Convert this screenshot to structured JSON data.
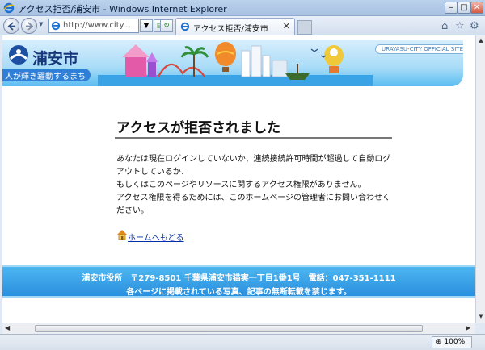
{
  "window": {
    "title": "アクセス拒否/浦安市 - Windows Internet Explorer",
    "minimize_icon": "minimize-icon",
    "maximize_icon": "maximize-icon",
    "close_icon": "close-icon"
  },
  "toolbar": {
    "address_value": "http://www.city...",
    "tab_title": "アクセス拒否/浦安市",
    "tab_close": "✕",
    "home_icon": "home-icon",
    "favorites_icon": "star-icon",
    "tools_icon": "gear-icon"
  },
  "banner": {
    "city_name": "浦安市",
    "slogan": "人が輝き躍動するまち",
    "official_site": "URAYASU-CITY OFFICIAL SITE"
  },
  "content": {
    "heading": "アクセスが拒否されました",
    "message_1": "あなたは現在ログインしていないか、連続接続許可時間が超過して自動ログアウトしているか、",
    "message_2": "もしくはこのページやリソースに関するアクセス権限がありません。",
    "message_3": "アクセス権限を得るためには、このホームページの管理者にお問い合わせください。",
    "home_link": "ホームへもどる"
  },
  "footer": {
    "line1": "浦安市役所　〒279-8501 千葉県浦安市猫実一丁目1番1号　電話：047-351-1111",
    "line2": "各ページに掲載されている写真、記事の無断転載を禁じます。"
  },
  "status": {
    "zoom": "100%"
  },
  "colors": {
    "footer_blue": "#2a8fde",
    "link_blue": "#0030a8",
    "banner_sky": "#a8dcf8"
  }
}
